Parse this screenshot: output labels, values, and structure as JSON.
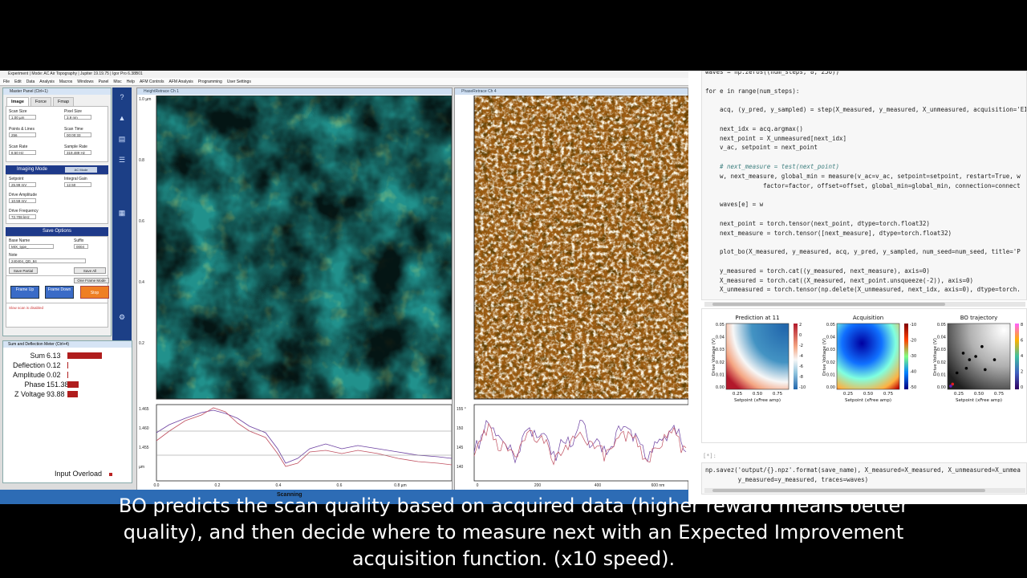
{
  "afm": {
    "window_title": "Experiment | Mode: AC Air Topography | Jupiter 19.19.75 | Igor Pro 6.38B01",
    "menu": [
      "File",
      "Edit",
      "Data",
      "Analysis",
      "Macros",
      "Windows",
      "Panel",
      "Misc",
      "Help",
      "AFM Controls",
      "AFM Analysis",
      "Programming",
      "User Settings"
    ],
    "master_panel": {
      "title": "Master Panel (Ctrl+1)",
      "tabs": [
        "Image",
        "Force",
        "Fmap"
      ],
      "params": [
        {
          "label": "Scan Size",
          "value": "1.00 µm"
        },
        {
          "label": "Pixel Size",
          "value": "3.9 nm"
        },
        {
          "label": "Points & Lines",
          "value": "256"
        },
        {
          "label": "Scan Time",
          "value": "00:00:33"
        },
        {
          "label": "Scan Rate",
          "value": "8.50 Hz"
        },
        {
          "label": "Sample Rate",
          "value": "319.489 Hz"
        }
      ],
      "imaging_mode": {
        "title": "Imaging Mode",
        "mode": "AC Mode",
        "params": [
          {
            "label": "Setpoint",
            "value": "25.99 mV"
          },
          {
            "label": "Integral Gain",
            "value": "12.50"
          },
          {
            "label": "Drive Amplitude",
            "value": "10.59 mV"
          },
          {
            "label": "Drive Frequency",
            "value": "72.708 kHz"
          }
        ]
      },
      "save_options": {
        "title": "Save Options",
        "base_name_label": "Base Name",
        "base_name": "MIX_type_",
        "suffix_label": "Suffix",
        "suffix": "0004",
        "note_label": "Note",
        "note": "240404_QD_84",
        "save_partial": "Save Partial",
        "save_all": "Save All"
      },
      "frame_mode": "One Frame Mode",
      "frame_up": "Frame Up",
      "frame_down": "Frame Down",
      "stop": "Stop",
      "status": "Slow scan is disabled"
    },
    "side_icons": [
      "help-icon",
      "sample-icon",
      "tune-icon",
      "parms-icon",
      "path-icon",
      "settings-icon"
    ],
    "meter": {
      "title": "Sum and Deflection Meter (Ctrl+4)",
      "rows": [
        {
          "label": "Sum",
          "value": "6.13",
          "level": 0.45
        },
        {
          "label": "Deflection",
          "value": "0.12",
          "level": 0.01
        },
        {
          "label": "Amplitude",
          "value": "0.02",
          "level": 0.01
        },
        {
          "label": "Phase",
          "value": "151.38",
          "level": 0.15
        },
        {
          "label": "Z Voltage",
          "value": "93.88",
          "level": 0.14
        }
      ],
      "overload": "Input Overload"
    },
    "channel1": {
      "title": "HeightRetrace Ch 1",
      "yticks": [
        "1.0 µm",
        "0.8",
        "0.6",
        "0.4",
        "0.2"
      ],
      "profile_yticks": [
        "1.465",
        "1.460",
        "1.455",
        "µm"
      ],
      "profile_xticks": [
        "0.0",
        "0.2",
        "0.4",
        "0.6",
        "0.8 µm"
      ]
    },
    "channel2": {
      "title": "PhaseRetrace Ch 4",
      "profile_yticks": [
        "155 °",
        "150",
        "145",
        "140"
      ],
      "profile_xticks": [
        "0",
        "200",
        "400",
        "600 nm"
      ]
    },
    "status_scanning": "Scanning"
  },
  "notebook": {
    "code_cell_1": [
      {
        "indent": 0,
        "text": "waves = np.zeros((num_steps, 8, 256))"
      },
      {
        "indent": 0,
        "text": ""
      },
      {
        "indent": 0,
        "text": "for e in range(num_steps):"
      },
      {
        "indent": 0,
        "text": ""
      },
      {
        "indent": 1,
        "text": "acq, (y_pred, y_sampled) = step(X_measured, y_measured, X_unmeasured, acquisition='EI'"
      },
      {
        "indent": 0,
        "text": ""
      },
      {
        "indent": 1,
        "text": "next_idx = acq.argmax()"
      },
      {
        "indent": 1,
        "text": "next_point = X_unmeasured[next_idx]"
      },
      {
        "indent": 1,
        "text": "v_ac, setpoint = next_point"
      },
      {
        "indent": 0,
        "text": ""
      },
      {
        "indent": 1,
        "text": "# next_measure = test(next_point)"
      },
      {
        "indent": 1,
        "text": "w, next_measure, global_min = measure(v_ac=v_ac, setpoint=setpoint, restart=True, w"
      },
      {
        "indent": 4,
        "text": "factor=factor, offset=offset, global_min=global_min, connection=connect"
      },
      {
        "indent": 0,
        "text": ""
      },
      {
        "indent": 1,
        "text": "waves[e] = w"
      },
      {
        "indent": 0,
        "text": ""
      },
      {
        "indent": 1,
        "text": "next_point = torch.tensor(next_point, dtype=torch.float32)"
      },
      {
        "indent": 1,
        "text": "next_measure = torch.tensor([next_measure], dtype=torch.float32)"
      },
      {
        "indent": 0,
        "text": ""
      },
      {
        "indent": 1,
        "text": "plot_bo(X_measured, y_measured, acq, y_pred, y_sampled, num_seed=num_seed, title='P"
      },
      {
        "indent": 0,
        "text": ""
      },
      {
        "indent": 1,
        "text": "y_measured = torch.cat((y_measured, next_measure), axis=0)"
      },
      {
        "indent": 1,
        "text": "X_measured = torch.cat((X_measured, next_point.unsqueeze(-2)), axis=0)"
      },
      {
        "indent": 1,
        "text": "X_unmeasured = torch.tensor(np.delete(X_unmeasured, next_idx, axis=0), dtype=torch."
      }
    ],
    "plots": [
      {
        "title": "Prediction at 11",
        "cbar": [
          "2",
          "0",
          "-2",
          "-4",
          "-6",
          "-8",
          "-10"
        ]
      },
      {
        "title": "Acquisition",
        "cbar": [
          "-10",
          "-20",
          "-30",
          "-40",
          "-50"
        ]
      },
      {
        "title": "BO trajectory",
        "cbar": [
          "8",
          "6",
          "4",
          "2",
          "0"
        ]
      }
    ],
    "plot_xlabel": "Setpoint (xFree amp)",
    "plot_ylabel": "Drive Voltage (V)",
    "plot_xticks": [
      "0.25",
      "0.50",
      "0.75"
    ],
    "plot_yticks": [
      "0.05",
      "0.04",
      "0.03",
      "0.02",
      "0.01",
      "0.00"
    ],
    "empty_prompt": "[*]:",
    "code_cell_2": [
      "np.savez('output/{}.npz'.format(save_name), X_measured=X_measured, X_unmeasured=X_unmea",
      "         y_measured=y_measured, traces=waves)"
    ]
  },
  "subtitle": [
    "BO predicts the scan quality based on acquired data (higher reward means better",
    "quality), and then decide where to measure next with an Expected Improvement",
    "acquisition function.  (x10 speed)."
  ],
  "colors": {
    "accent_blue": "#1e3a8a",
    "stop_orange": "#ef7f24",
    "meter_red": "#b01d1d"
  }
}
